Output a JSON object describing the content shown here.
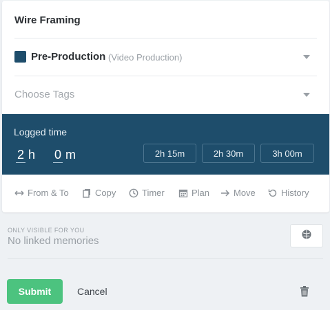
{
  "entry": {
    "title": "Wire Framing"
  },
  "project": {
    "name": "Pre-Production",
    "client": "(Video Production)",
    "color": "#1e4d6b"
  },
  "tags": {
    "placeholder": "Choose Tags"
  },
  "logged_time": {
    "label": "Logged time",
    "hours": "2",
    "hours_unit": "h",
    "minutes": "0",
    "minutes_unit": "m",
    "presets": [
      "2h 15m",
      "2h 30m",
      "3h 00m"
    ]
  },
  "actions": [
    {
      "label": "From & To",
      "icon": "arrows-horizontal-icon"
    },
    {
      "label": "Copy",
      "icon": "copy-icon"
    },
    {
      "label": "Timer",
      "icon": "clock-icon"
    },
    {
      "label": "Plan",
      "icon": "calendar-icon"
    },
    {
      "label": "Move",
      "icon": "arrow-right-icon"
    },
    {
      "label": "History",
      "icon": "history-icon"
    }
  ],
  "memories": {
    "visibility_label": "ONLY VISIBLE FOR YOU",
    "empty_text": "No linked memories",
    "button_icon": "brain-icon"
  },
  "footer": {
    "submit_label": "Submit",
    "cancel_label": "Cancel",
    "delete_icon": "trash-icon"
  },
  "colors": {
    "accent": "#1e4d6b",
    "submit": "#4cc37f",
    "background": "#eef1f4"
  }
}
